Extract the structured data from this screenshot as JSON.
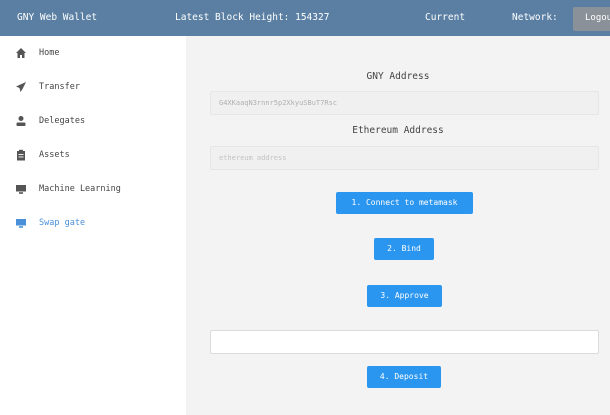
{
  "header": {
    "app_title": "GNY Web Wallet",
    "block_height": "Latest Block Height: 154327",
    "current": "Current",
    "network": "Network:",
    "logout_label": "Logou"
  },
  "sidebar": {
    "items": [
      {
        "label": "Home",
        "icon": "home-icon"
      },
      {
        "label": "Transfer",
        "icon": "send-icon"
      },
      {
        "label": "Delegates",
        "icon": "user-icon"
      },
      {
        "label": "Assets",
        "icon": "clipboard-icon"
      },
      {
        "label": "Machine Learning",
        "icon": "monitor-icon"
      },
      {
        "label": "Swap gate",
        "icon": "monitor-icon",
        "active": true
      }
    ]
  },
  "main": {
    "gny_address_label": "GNY Address",
    "gny_address_value": "G4XKaaqN3rnnr5p2XkyuSBuT7Rsc",
    "eth_address_label": "Ethereum Address",
    "eth_address_placeholder": "ethereum address",
    "connect_button": "1. Connect to metamask",
    "bind_button": "2. Bind",
    "approve_button": "3. Approve",
    "amount_value": "",
    "deposit_button": "4. Deposit"
  },
  "colors": {
    "header_bg": "#5a7fa3",
    "primary_button": "#2b96ef",
    "active_item": "#4a90d9"
  }
}
